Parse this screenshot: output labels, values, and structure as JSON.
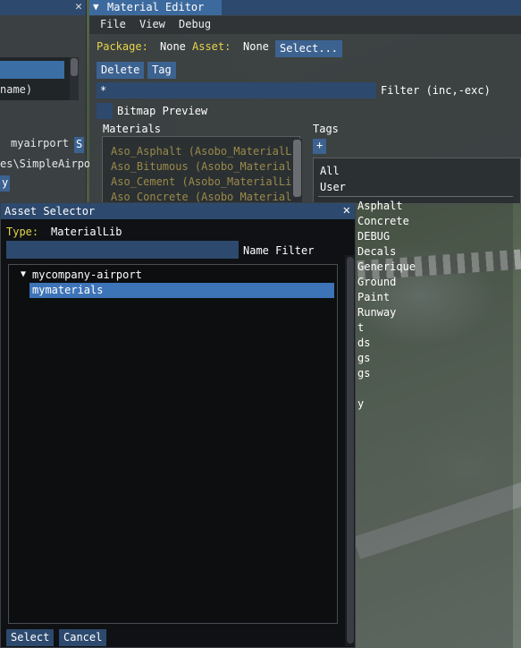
{
  "left_window": {
    "text_name": "name)",
    "text_airport": "myairport",
    "text_path": "es\\SimpleAirpo",
    "btn_s": "S",
    "btn_y": "y"
  },
  "material_editor": {
    "title": "Material Editor",
    "menu": [
      "File",
      "View",
      "Debug"
    ],
    "package_label": "Package:",
    "package_value": "None",
    "asset_label": "Asset:",
    "asset_value": "None",
    "select_button": "Select...",
    "delete_button": "Delete",
    "tag_button": "Tag",
    "filter_value": "*",
    "filter_label": "Filter (inc,-exc)",
    "bitmap_preview_label": "Bitmap Preview",
    "materials_header": "Materials",
    "tags_header": "Tags",
    "tags_add_button": "+",
    "materials": [
      "Aso_Asphalt (Asobo_MaterialL",
      "Aso_Bitumous (Asobo_Materiall",
      "Aso_Cement (Asobo_MaterialLi",
      "Aso_Concrete (Asobo_MaterialL"
    ],
    "tags": [
      "All",
      "User",
      "Asphalt",
      "Concrete",
      "DEBUG",
      "Decals",
      "Generique",
      "Ground",
      "Paint",
      "Runway",
      "t",
      "ds",
      "gs",
      "gs",
      "y"
    ]
  },
  "asset_selector": {
    "title": "Asset Selector",
    "type_label": "Type:",
    "type_value": "MaterialLib",
    "name_filter_label": "Name Filter",
    "name_filter_value": "",
    "tree": {
      "root": "mycompany-airport",
      "child": "mymaterials"
    },
    "select_button": "Select",
    "cancel_button": "Cancel"
  },
  "colors": {
    "accent": "#3d74b8",
    "title_bar": "#2d4a6e",
    "label_yellow": "#e6d44a",
    "material_text": "#9a8a4a"
  }
}
